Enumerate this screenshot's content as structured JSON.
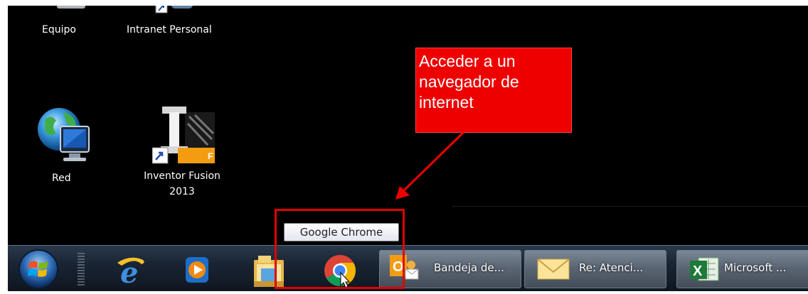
{
  "desktop": {
    "icons": [
      {
        "name": "computer-icon",
        "label": "Equipo"
      },
      {
        "name": "intranet-icon",
        "label": "Intranet Personal"
      },
      {
        "name": "network-icon",
        "label": "Red"
      },
      {
        "name": "inventor-icon",
        "label": "Inventor Fusion\n2013"
      }
    ]
  },
  "callout": {
    "text": "Acceder a un\nnavegador de\ninternet",
    "color": "#ee0000"
  },
  "tooltip": {
    "text": "Google Chrome"
  },
  "taskbar": {
    "start_icon": "windows-start-orb-icon",
    "pinned": [
      {
        "name": "internet-explorer-icon"
      },
      {
        "name": "media-player-icon"
      },
      {
        "name": "file-explorer-icon"
      },
      {
        "name": "chrome-icon"
      }
    ],
    "windows": [
      {
        "icon": "outlook-icon",
        "label": "Bandeja de..."
      },
      {
        "icon": "mail-envelope-icon",
        "label": "Re: Atenci..."
      },
      {
        "icon": "excel-icon",
        "label": "Microsoft ..."
      }
    ]
  }
}
